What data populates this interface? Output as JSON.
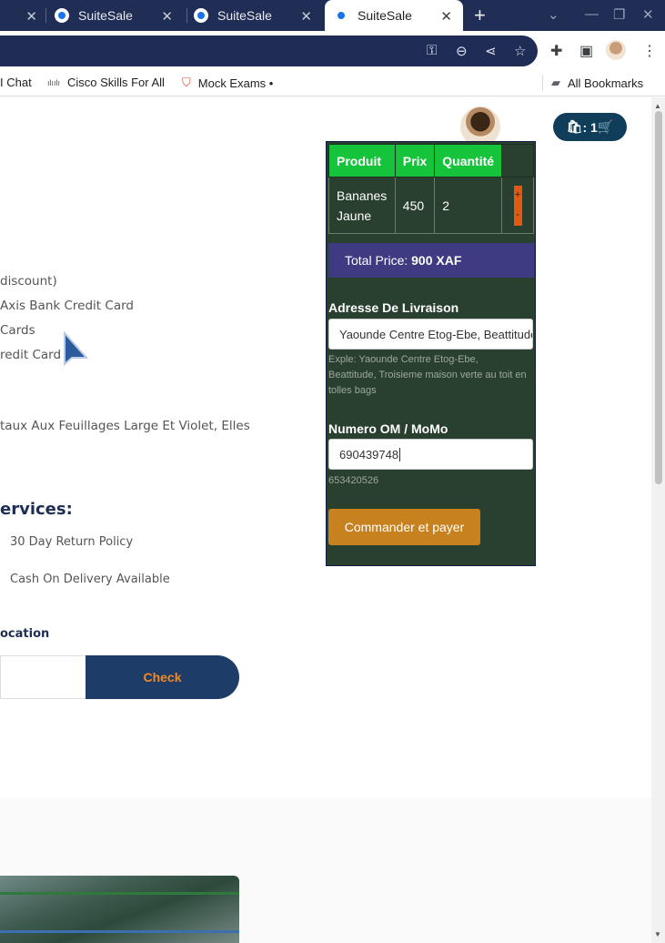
{
  "browser": {
    "tabs": [
      {
        "label": ""
      },
      {
        "label": "SuiteSale"
      },
      {
        "label": "SuiteSale"
      },
      {
        "label": "SuiteSale"
      }
    ],
    "new_tab_label": "+",
    "bookmarks": [
      {
        "label": "I Chat",
        "icon": "chat-icon"
      },
      {
        "label": "Cisco Skills For All",
        "icon": "cisco-icon"
      },
      {
        "label": "Mock Exams •",
        "icon": "shield-icon"
      }
    ],
    "all_bookmarks_label": "All Bookmarks"
  },
  "page": {
    "left_lines": [
      "discount)",
      "Axis Bank Credit Card",
      "Cards",
      "redit Card",
      "taux Aux Feuillages Large Et Violet, Elles"
    ],
    "services": {
      "title": "ervices:",
      "items": [
        "30 Day Return Policy",
        "Cash On Delivery Available"
      ]
    },
    "location": {
      "label": "ocation",
      "check_label": "Check"
    },
    "cart_badge": ": 1"
  },
  "cart": {
    "headers": [
      "Produit",
      "Prix",
      "Quantité",
      ""
    ],
    "rows": [
      {
        "product": "Bananes Jaune",
        "price": "450",
        "quantity": "2",
        "plus": "+",
        "minus": "-"
      }
    ],
    "total_label": "Total Price:",
    "total_value": "900 XAF",
    "address": {
      "label": "Adresse De Livraison",
      "value": "Yaounde Centre Etog-Ebe, Beattitude",
      "hint": "Exple: Yaounde Centre Etog-Ebe, Beattitude, Troisieme maison verte au toit en tolles bags"
    },
    "momo": {
      "label": "Numero OM / MoMo",
      "value": "690439748",
      "hint": "653420526"
    },
    "pay_label": "Commander et payer"
  },
  "colors": {
    "cart_bg": "#29402f",
    "table_header": "#16c43b",
    "total_bar": "#3e3b82",
    "pay_button": "#c8811f",
    "check_button": "#1e3c68",
    "check_text": "#f08a24",
    "chrome_tabstrip": "#202d55"
  }
}
